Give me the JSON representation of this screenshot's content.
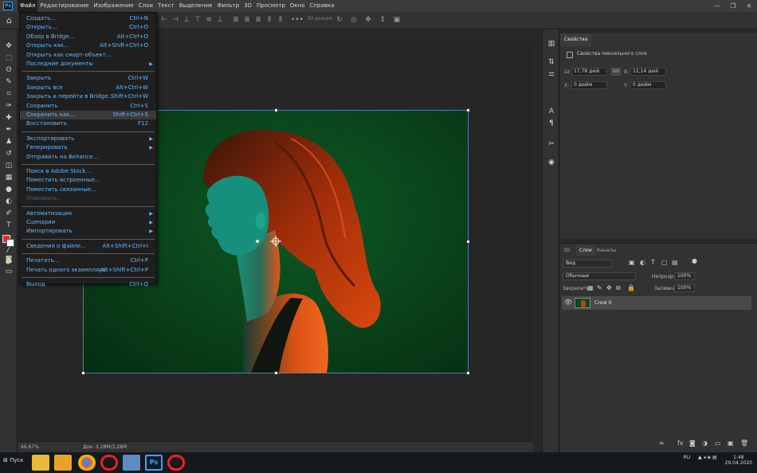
{
  "app": {
    "logo": "Ps",
    "window_controls": [
      "—",
      "❐",
      "✕"
    ]
  },
  "menubar": [
    "Файл",
    "Редактирование",
    "Изображение",
    "Слои",
    "Текст",
    "Выделение",
    "Фильтр",
    "3D",
    "Просмотр",
    "Окно",
    "Справка"
  ],
  "optionsbar": {
    "three_d_label": "3D-режим"
  },
  "file_menu": {
    "items": [
      {
        "label": "Создать...",
        "shortcut": "Ctrl+N"
      },
      {
        "label": "Открыть...",
        "shortcut": "Ctrl+O"
      },
      {
        "label": "Обзор в Bridge...",
        "shortcut": "Alt+Ctrl+O"
      },
      {
        "label": "Открыть как...",
        "shortcut": "Alt+Shift+Ctrl+O"
      },
      {
        "label": "Открыть как смарт-объект...",
        "shortcut": ""
      },
      {
        "label": "Последние документы",
        "shortcut": "",
        "submenu": true
      },
      {
        "label": "Закрыть",
        "shortcut": "Ctrl+W"
      },
      {
        "label": "Закрыть все",
        "shortcut": "Alt+Ctrl+W"
      },
      {
        "label": "Закрыть и перейти в Bridge...",
        "shortcut": "Shift+Ctrl+W"
      },
      {
        "label": "Сохранить",
        "shortcut": "Ctrl+S"
      },
      {
        "label": "Сохранить как...",
        "shortcut": "Shift+Ctrl+S",
        "highlighted": true
      },
      {
        "label": "Восстановить",
        "shortcut": "F12"
      },
      {
        "label": "Экспортировать",
        "shortcut": "",
        "submenu": true
      },
      {
        "label": "Генерировать",
        "shortcut": "",
        "submenu": true
      },
      {
        "label": "Отправить на Behance...",
        "shortcut": ""
      },
      {
        "label": "Поиск в Adobe Stock...",
        "shortcut": ""
      },
      {
        "label": "Поместить встроенные...",
        "shortcut": ""
      },
      {
        "label": "Поместить связанные...",
        "shortcut": ""
      },
      {
        "label": "Упаковать...",
        "shortcut": "",
        "disabled": true
      },
      {
        "label": "Автоматизация",
        "shortcut": "",
        "submenu": true
      },
      {
        "label": "Сценарии",
        "shortcut": "",
        "submenu": true
      },
      {
        "label": "Импортировать",
        "shortcut": "",
        "submenu": true
      },
      {
        "label": "Сведения о файле...",
        "shortcut": "Alt+Shift+Ctrl+I"
      },
      {
        "label": "Печатать...",
        "shortcut": "Ctrl+P"
      },
      {
        "label": "Печать одного экземпляра",
        "shortcut": "Alt+Shift+Ctrl+P"
      },
      {
        "label": "Выход",
        "shortcut": "Ctrl+Q"
      }
    ]
  },
  "statusbar": {
    "zoom": "66.67%",
    "doc": "Док: 3,28M/3,28M"
  },
  "properties": {
    "tab": "Свойства",
    "subtitle": "Свойства пиксельного слоя",
    "w_label": "Ш:",
    "w_value": "17,78 дюй",
    "link_icon": "GO",
    "h_label": "В:",
    "h_value": "12,14 дюй",
    "x_label": "X:",
    "x_value": "0 дюйм",
    "y_label": "Y:",
    "y_value": "0 дюйм"
  },
  "layers_panel": {
    "tabs": [
      "3D",
      "Слои",
      "Каналы"
    ],
    "filter": "Вид",
    "blend_mode": "Обычные",
    "opacity_label": "Непрозрачность:",
    "opacity_value": "100%",
    "lock_label": "Закрепить:",
    "fill_label": "Заливка:",
    "fill_value": "100%",
    "layer_name": "Слой 0"
  },
  "taskbar": {
    "start": "Пуск",
    "lang": "RU",
    "time": "1:48",
    "date": "29.04.2020",
    "apps": [
      "file-explorer",
      "media-player",
      "chrome",
      "opera",
      "photo-viewer",
      "photoshop",
      "opera-gx"
    ]
  },
  "colors": {
    "accent_menu_text": "#66b8ff",
    "foreground": "#e8301c",
    "background": "#ffffff"
  }
}
